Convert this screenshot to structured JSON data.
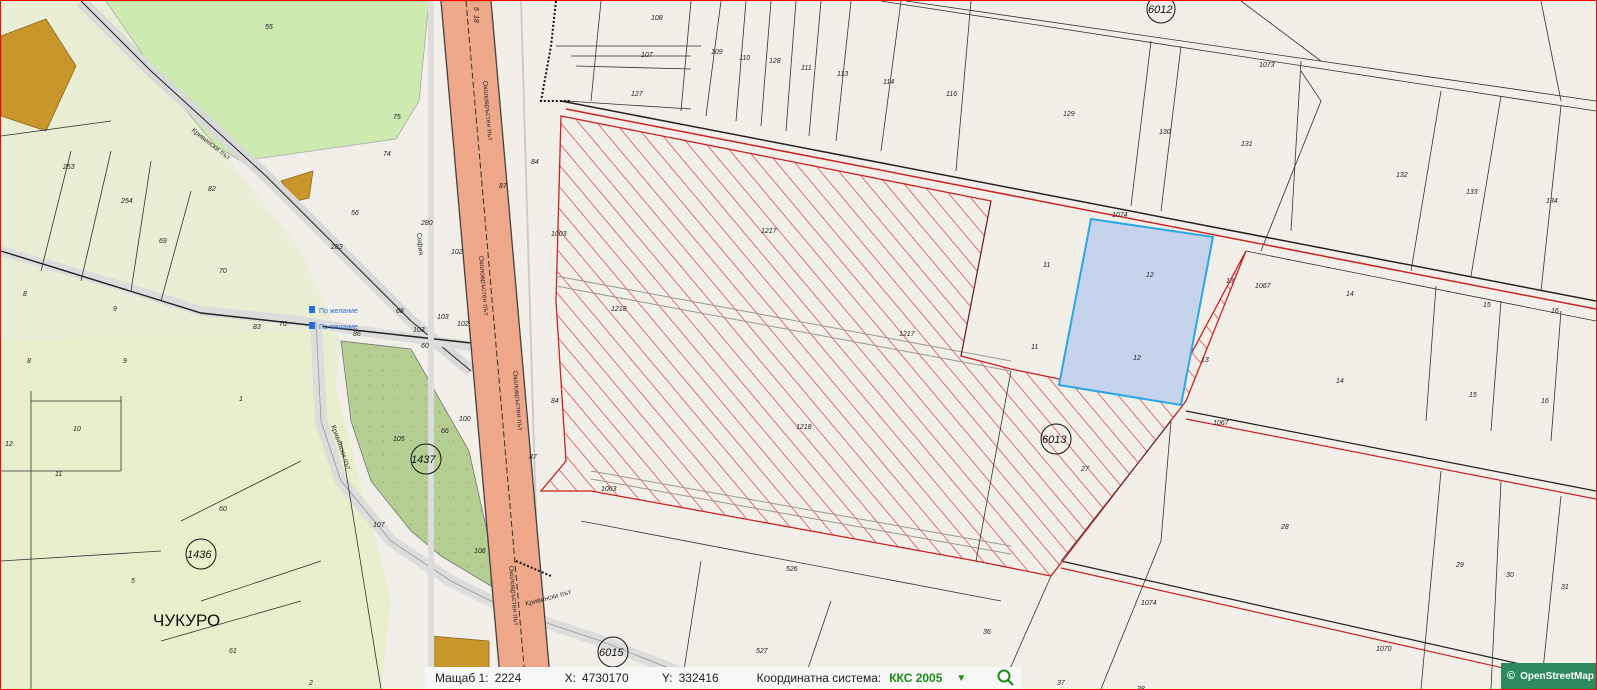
{
  "map": {
    "area_name": "ЧУКУРО",
    "road_labels": {
      "ring_road_a": "Околовръстен път",
      "ring_road_b": "Околовръстен път",
      "ring_road_c": "Околовръстен път",
      "ring_road_d": "Околовръстен път",
      "kremikovski": "Кривински път",
      "kremikovski_b": "Кривински път",
      "kremikovski_c": "Кривински път",
      "sofia": "София"
    },
    "poi_labels": {
      "po_zhelanie_1": "По желание",
      "po_zhelanie_2": "По желание"
    },
    "circled_labels": [
      "6012",
      "1437",
      "1436",
      "6013",
      "6015"
    ],
    "parcel_numbers": {
      "p55": "55",
      "p75": "75",
      "p74": "74",
      "p82": "82",
      "p253": "253",
      "p254": "254",
      "p69": "69",
      "p70": "70",
      "p8a": "8",
      "p9a": "9",
      "p8b": "8",
      "p9b": "9",
      "p1": "1",
      "p10": "10",
      "p11a": "11",
      "p12a": "12",
      "p60": "60",
      "p5": "5",
      "p61": "61",
      "p2": "2",
      "p56": "56",
      "p280": "280",
      "p283": "283",
      "p102a": "102",
      "p86": "86",
      "p103": "103",
      "p102b": "102",
      "p103b": "103",
      "p60b": "60",
      "p100": "100",
      "p105": "105",
      "p66": "66",
      "p107": "107",
      "p106": "106",
      "p84a": "84",
      "p84b": "84",
      "p87a": "87",
      "p87b": "87",
      "p108": "108",
      "p107b": "107",
      "p127": "127",
      "p109": "109",
      "p110": "110",
      "p128": "128",
      "p111": "111",
      "p113": "113",
      "p114": "114",
      "p116": "116",
      "p129": "129",
      "p130": "130",
      "p131": "131",
      "p1073": "1073",
      "p132": "132",
      "p133": "133",
      "p134": "134",
      "p1074": "1074",
      "p1217a": "1217",
      "p1217b": "1217",
      "p1218a": "1218",
      "p1218b": "1218",
      "p1003": "1003",
      "p1063": "1063",
      "p11b": "11",
      "p11c": "11",
      "p12b": "12",
      "p12c": "12",
      "p13a": "13",
      "p13b": "13",
      "p1067a": "1067",
      "p1067b": "1067",
      "p14a": "14",
      "p14b": "14",
      "p15a": "15",
      "p15b": "15",
      "p16a": "16",
      "p16b": "16",
      "p27": "27",
      "p28": "28",
      "p29": "29",
      "p30": "30",
      "p31": "31",
      "p526": "526",
      "p527": "527",
      "p36": "36",
      "p37": "37",
      "p38": "38",
      "p1074b": "1074",
      "p1070": "1070",
      "p83": "83",
      "p70b": "70",
      "p68": "68",
      "p18": "18",
      "p6": "6"
    }
  },
  "status_bar": {
    "scale_label": "Мащаб 1:",
    "scale_value": "2224",
    "x_label": "X:",
    "x_value": "4730170",
    "y_label": "Y:",
    "y_value": "332416",
    "crs_label": "Координатна система:",
    "crs_value": "ККС 2005",
    "dropdown_icon": "▼",
    "search_icon": "magnifier-icon"
  },
  "attribution": {
    "symbol": "©",
    "text": "OpenStreetMap"
  },
  "colors": {
    "frame_border": "#ff0000",
    "selected_fill": "#c5d3ec",
    "selected_border": "#29a7e6",
    "hatch": "#d42020",
    "road": "#f0a88a",
    "green_area": "#cdeab0",
    "building": "#c8962b",
    "attribution_bg": "#2c8a5e",
    "crs_green": "#1a8f1a"
  }
}
